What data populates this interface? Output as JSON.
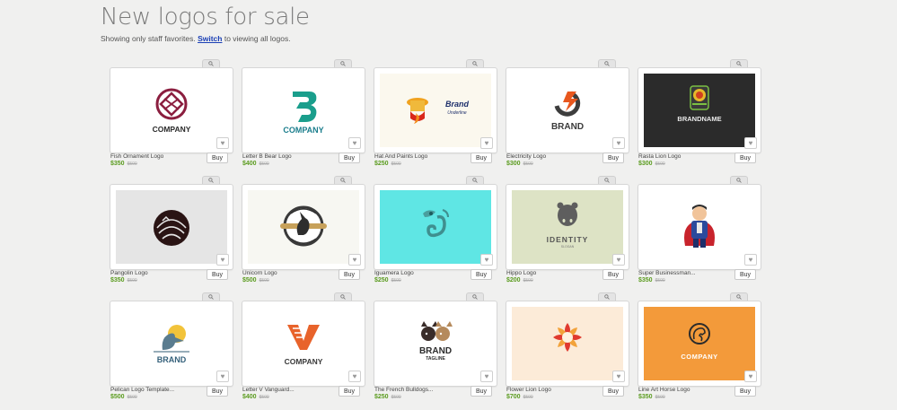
{
  "header": {
    "title": "New logos for sale",
    "subtitle_prefix": "Showing only staff favorites.",
    "switch_label": "Switch",
    "subtitle_suffix": "to viewing all logos."
  },
  "colors": {
    "price": "#5a9b1e",
    "link": "#1a3fb5",
    "background": "#f0f0ef"
  },
  "logos": [
    {
      "name": "Fish Ornament Logo",
      "price": "$350",
      "old": "$500",
      "buy": "Buy",
      "thumb_bg": "#ffffff",
      "brand": "COMPANY",
      "icon": "fish-ornament-icon"
    },
    {
      "name": "Letter B Bear Logo",
      "price": "$400",
      "old": "$500",
      "buy": "Buy",
      "thumb_bg": "#ffffff",
      "brand": "COMPANY",
      "icon": "letter-b-bear-icon"
    },
    {
      "name": "Hat And Paints Logo",
      "price": "$250",
      "old": "$500",
      "buy": "Buy",
      "thumb_bg": "#fbf8ee",
      "brand": "Brand",
      "tagline": "Underline",
      "icon": "hat-paint-icon"
    },
    {
      "name": "Electricity Logo",
      "price": "$300",
      "old": "$500",
      "buy": "Buy",
      "thumb_bg": "#ffffff",
      "brand": "BRAND",
      "icon": "electricity-plug-icon"
    },
    {
      "name": "Rasta Lion Logo",
      "price": "$300",
      "old": "$500",
      "buy": "Buy",
      "thumb_bg": "#2b2b2b",
      "brand": "BRANDNAME",
      "icon": "rasta-lion-icon"
    },
    {
      "name": "Pangolin Logo",
      "price": "$350",
      "old": "$500",
      "buy": "Buy",
      "thumb_bg": "#e5e5e5",
      "brand": "",
      "icon": "pangolin-icon"
    },
    {
      "name": "Unicorn Logo",
      "price": "$500",
      "old": "$500",
      "buy": "Buy",
      "thumb_bg": "#f7f7f2",
      "brand": "",
      "icon": "unicorn-badge-icon"
    },
    {
      "name": "Iguamera Logo",
      "price": "$250",
      "old": "$500",
      "buy": "Buy",
      "thumb_bg": "#5fe6e4",
      "brand": "",
      "icon": "iguana-icon"
    },
    {
      "name": "Hippo Logo",
      "price": "$200",
      "old": "$500",
      "buy": "Buy",
      "thumb_bg": "#dde3c5",
      "brand": "IDENTITY",
      "tagline": "SLOGAN",
      "icon": "hippo-icon"
    },
    {
      "name": "Super Businessman...",
      "price": "$350",
      "old": "$500",
      "buy": "Buy",
      "thumb_bg": "#ffffff",
      "brand": "",
      "icon": "superhero-businessman-icon"
    },
    {
      "name": "Pelican Logo Template...",
      "price": "$500",
      "old": "$500",
      "buy": "Buy",
      "thumb_bg": "#ffffff",
      "brand": "BRAND",
      "icon": "pelican-icon"
    },
    {
      "name": "Letter V Vanguard...",
      "price": "$400",
      "old": "$500",
      "buy": "Buy",
      "thumb_bg": "#ffffff",
      "brand": "COMPANY",
      "icon": "letter-v-icon"
    },
    {
      "name": "The French Bulldogs...",
      "price": "$250",
      "old": "$500",
      "buy": "Buy",
      "thumb_bg": "#ffffff",
      "brand": "BRAND",
      "tagline": "TAGLINE",
      "icon": "french-bulldogs-icon"
    },
    {
      "name": "Flower Lion Logo",
      "price": "$700",
      "old": "$500",
      "buy": "Buy",
      "thumb_bg": "#fcebd8",
      "brand": "",
      "icon": "flower-lion-icon"
    },
    {
      "name": "Line Art Horse Logo",
      "price": "$350",
      "old": "$500",
      "buy": "Buy",
      "thumb_bg": "#f39a3a",
      "brand": "COMPANY",
      "icon": "line-art-horse-icon"
    }
  ]
}
